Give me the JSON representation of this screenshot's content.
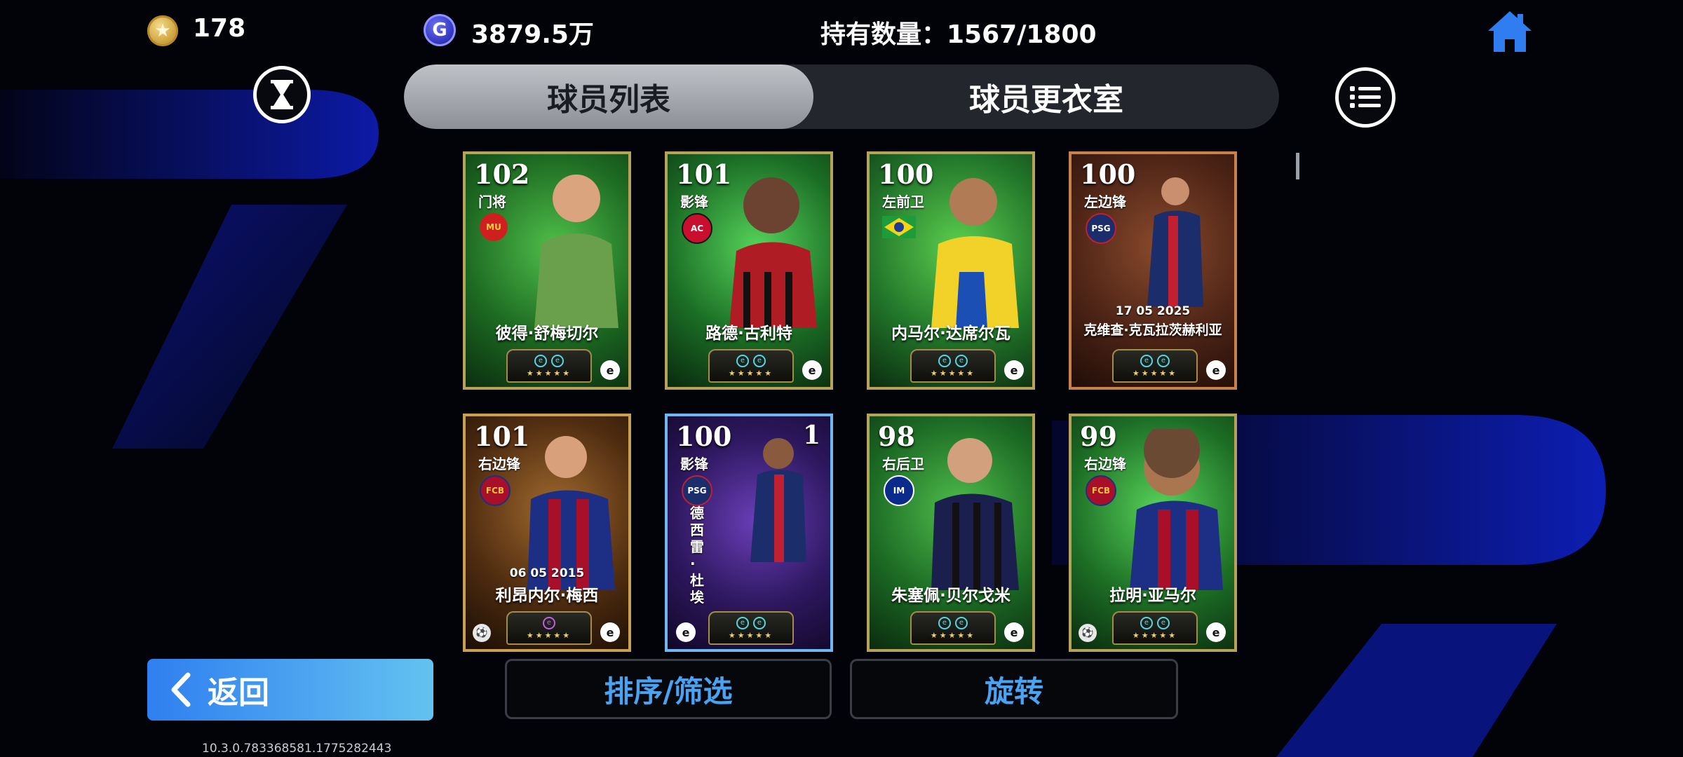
{
  "header": {
    "coins": "178",
    "gp_icon_letter": "G",
    "gp": "3879.5万",
    "holding": "持有数量：1567/1800"
  },
  "tabs": [
    {
      "label": "球员列表",
      "active": true
    },
    {
      "label": "球员更衣室",
      "active": false
    }
  ],
  "cards": [
    {
      "rating": "102",
      "position": "门将",
      "name": "彼得·舒梅切尔",
      "date": "",
      "club": "manchester-united",
      "theme": "green"
    },
    {
      "rating": "101",
      "position": "影锋",
      "name": "路德·古利特",
      "date": "",
      "club": "ac-milan",
      "theme": "green"
    },
    {
      "rating": "100",
      "position": "左前卫",
      "name": "内马尔·达席尔瓦",
      "date": "",
      "club": "brazil",
      "theme": "green"
    },
    {
      "rating": "100",
      "position": "左边锋",
      "name": "克维查·克瓦拉茨赫利亚",
      "date": "17 05 2025",
      "club": "psg",
      "theme": "bronze"
    },
    {
      "rating": "101",
      "position": "右边锋",
      "name": "利昂内尔·梅西",
      "date": "06 05 2015",
      "club": "barcelona",
      "theme": "bronze"
    },
    {
      "rating": "100",
      "position": "影锋",
      "name": "德西雷·杜埃",
      "date": "",
      "club": "psg",
      "theme": "purple",
      "count": "1"
    },
    {
      "rating": "98",
      "position": "右后卫",
      "name": "朱塞佩·贝尔戈米",
      "date": "",
      "club": "inter",
      "theme": "green"
    },
    {
      "rating": "99",
      "position": "右边锋",
      "name": "拉明·亚马尔",
      "date": "",
      "club": "barcelona",
      "theme": "green"
    }
  ],
  "footer": {
    "back_label": "返回",
    "sort_label": "排序/筛选",
    "rotate_label": "旋转",
    "version": "10.3.0.783368581.1775282443"
  },
  "colors": {
    "accent_blue": "#4aa3f2",
    "back_gradient_start": "#2f7ff0",
    "back_gradient_end": "#64c2f0"
  },
  "icons": {
    "coin": "coin-icon",
    "gp": "gp-icon",
    "home": "home-icon",
    "hourglass": "hourglass-icon",
    "menu": "list-menu-icon",
    "back": "chevron-left-icon"
  }
}
